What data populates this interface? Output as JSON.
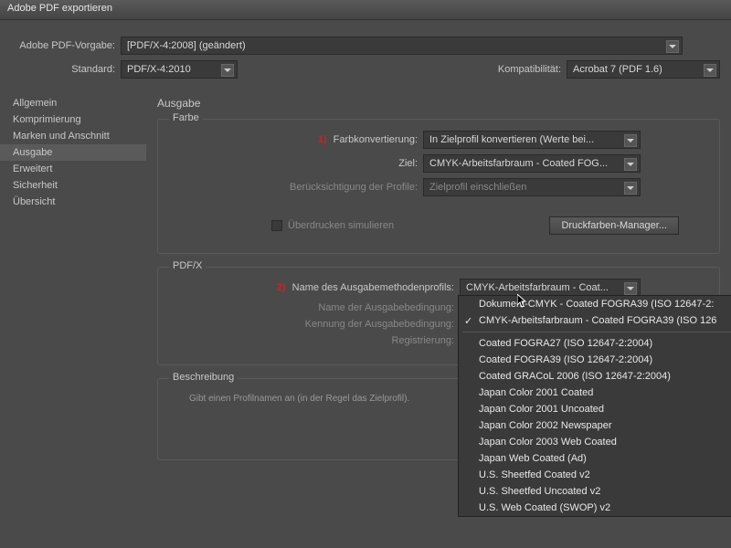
{
  "window": {
    "title": "Adobe PDF exportieren"
  },
  "top": {
    "vorgabe_label": "Adobe PDF-Vorgabe:",
    "vorgabe_value": "[PDF/X-4:2008] (geändert)",
    "standard_label": "Standard:",
    "standard_value": "PDF/X-4:2010",
    "kompat_label": "Kompatibilität:",
    "kompat_value": "Acrobat 7 (PDF 1.6)"
  },
  "sidebar": {
    "items": [
      {
        "label": "Allgemein"
      },
      {
        "label": "Komprimierung"
      },
      {
        "label": "Marken und Anschnitt"
      },
      {
        "label": "Ausgabe"
      },
      {
        "label": "Erweitert"
      },
      {
        "label": "Sicherheit"
      },
      {
        "label": "Übersicht"
      }
    ],
    "active_index": 3
  },
  "content": {
    "header": "Ausgabe",
    "farbe": {
      "legend": "Farbe",
      "annot1": "1)",
      "konvert_label": "Farbkonvertierung:",
      "konvert_value": "In Zielprofil konvertieren (Werte bei...",
      "ziel_label": "Ziel:",
      "ziel_value": "CMYK-Arbeitsfarbraum - Coated FOG...",
      "profile_label": "Berücksichtigung der Profile:",
      "profile_value": "Zielprofil einschließen",
      "overprint": "Überdrucken simulieren",
      "ink_manager": "Druckfarben-Manager..."
    },
    "pdfx": {
      "legend": "PDF/X",
      "annot2": "2)",
      "profile_name_label": "Name des Ausgabemethodenprofils:",
      "profile_name_value": "CMYK-Arbeitsfarbraum - Coat...",
      "cond_name_label": "Name der Ausgabebedingung:",
      "cond_id_label": "Kennung der Ausgabebedingung:",
      "reg_label": "Registrierung:"
    },
    "beschreibung": {
      "legend": "Beschreibung",
      "text": "Gibt einen Profilnamen an (in der Regel das Zielprofil)."
    }
  },
  "menu": {
    "items": [
      {
        "label": "Dokument-CMYK - Coated FOGRA39 (ISO 12647-2:"
      },
      {
        "label": "CMYK-Arbeitsfarbraum - Coated FOGRA39 (ISO 126",
        "checked": true
      },
      {
        "sep": true
      },
      {
        "label": "Coated FOGRA27 (ISO 12647-2:2004)"
      },
      {
        "label": "Coated FOGRA39 (ISO 12647-2:2004)"
      },
      {
        "label": "Coated GRACoL 2006 (ISO 12647-2:2004)"
      },
      {
        "label": "Japan Color 2001 Coated"
      },
      {
        "label": "Japan Color 2001 Uncoated"
      },
      {
        "label": "Japan Color 2002 Newspaper"
      },
      {
        "label": "Japan Color 2003 Web Coated"
      },
      {
        "label": "Japan Web Coated (Ad)"
      },
      {
        "label": "U.S. Sheetfed Coated v2"
      },
      {
        "label": "U.S. Sheetfed Uncoated v2"
      },
      {
        "label": "U.S. Web Coated (SWOP) v2"
      }
    ]
  }
}
